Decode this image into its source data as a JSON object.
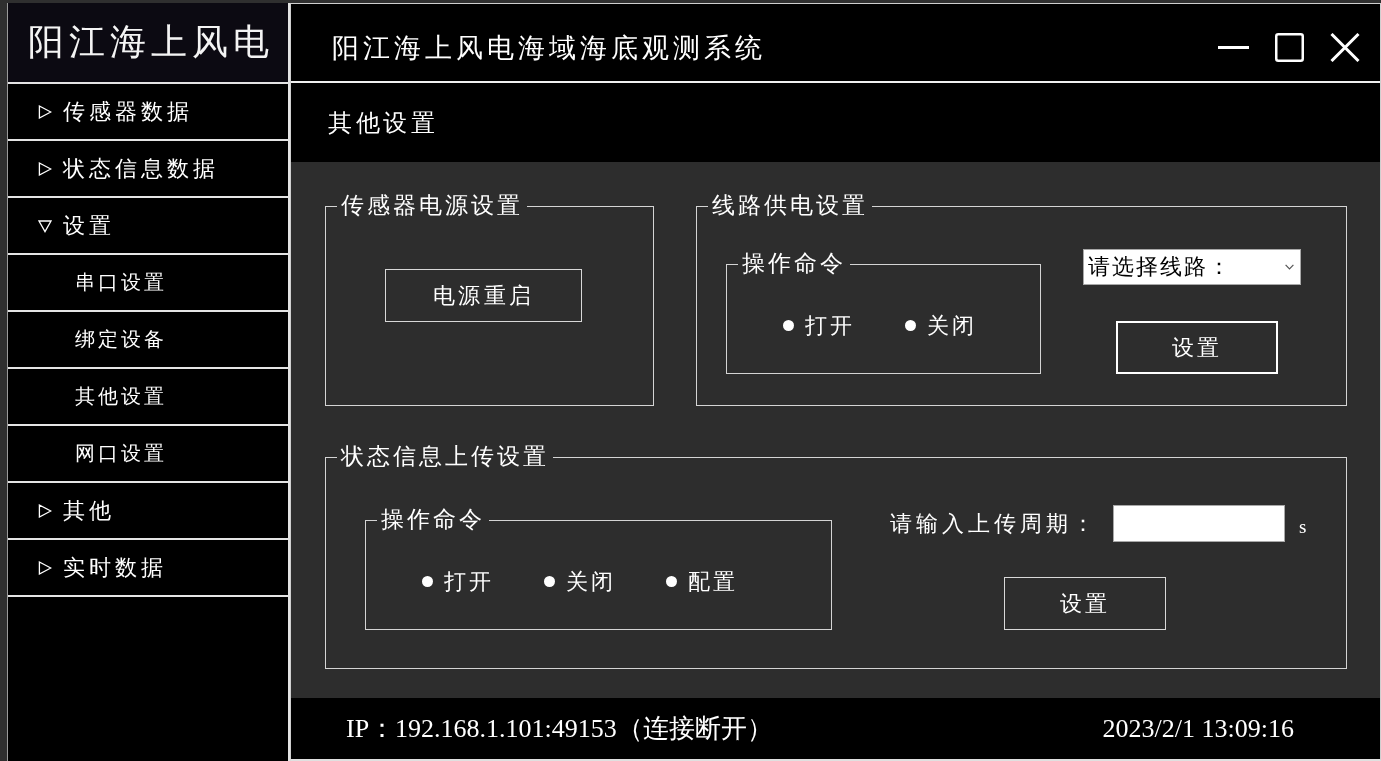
{
  "sidebar": {
    "logo": "阳江海上风电",
    "items": [
      {
        "label": "传感器数据",
        "expanded": false
      },
      {
        "label": "状态信息数据",
        "expanded": false
      },
      {
        "label": "设置",
        "expanded": true,
        "children": [
          {
            "label": "串口设置"
          },
          {
            "label": "绑定设备"
          },
          {
            "label": "其他设置"
          },
          {
            "label": "网口设置"
          }
        ]
      },
      {
        "label": "其他",
        "expanded": false
      },
      {
        "label": "实时数据",
        "expanded": false
      }
    ]
  },
  "window": {
    "title": "阳江海上风电海域海底观测系统"
  },
  "page_title": "其他设置",
  "sensor_power": {
    "title": "传感器电源设置",
    "button": {
      "label": "电源重启",
      "focused": false
    }
  },
  "line_power": {
    "title": "线路供电设置",
    "command": {
      "title": "操作命令",
      "options": [
        {
          "label": "打开",
          "selected": false
        },
        {
          "label": "关闭",
          "selected": false
        }
      ]
    },
    "line_select": {
      "placeholder": "请选择线路："
    },
    "button": {
      "label": "设置",
      "focused": true
    }
  },
  "status_upload": {
    "title": "状态信息上传设置",
    "command": {
      "title": "操作命令",
      "options": [
        {
          "label": "打开",
          "selected": false
        },
        {
          "label": "关闭",
          "selected": false
        },
        {
          "label": "配置",
          "selected": false
        }
      ]
    },
    "period_field": {
      "label": "请输入上传周期：",
      "unit": "s"
    },
    "button": {
      "label": "设置",
      "focused": false
    }
  },
  "status_bar": {
    "connection": "IP：192.168.1.101:49153（连接断开）",
    "datetime": "2023/2/1 13:09:16"
  }
}
